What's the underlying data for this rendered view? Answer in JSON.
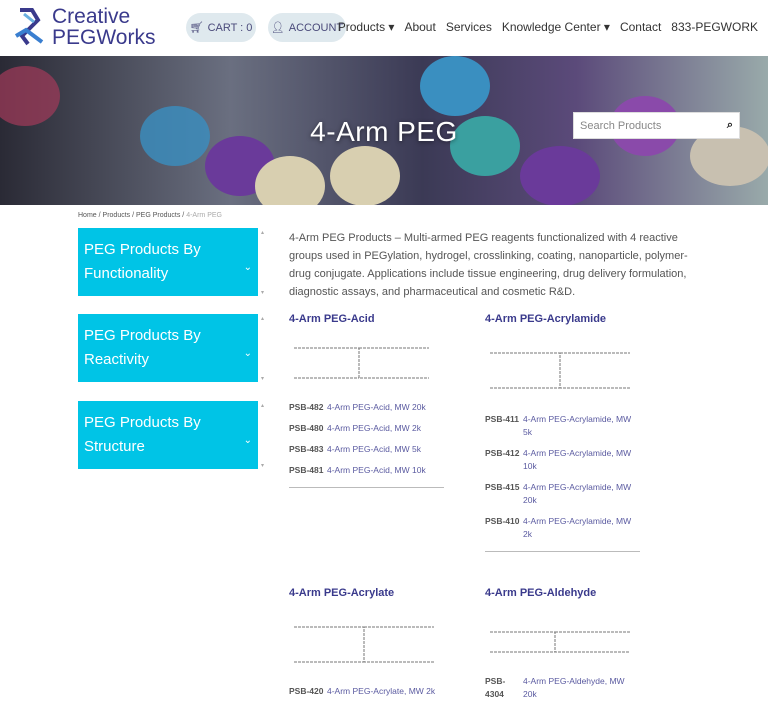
{
  "header": {
    "logo_line1": "Creative",
    "logo_line2": "PEGWorks",
    "cart": "CART : 0",
    "account": "ACCOUNT",
    "nav": [
      "Products",
      "About",
      "Services",
      "Knowledge Center",
      "Contact",
      "833-PEGWORK"
    ]
  },
  "banner": {
    "title": "4-Arm PEG",
    "search_placeholder": "Search Products"
  },
  "breadcrumb": {
    "items": [
      "Home",
      "Products",
      "PEG Products"
    ],
    "current": "4-Arm PEG"
  },
  "sidebar": [
    {
      "line1": "PEG Products By",
      "line2": "Functionality"
    },
    {
      "line1": "PEG Products By",
      "line2": "Reactivity"
    },
    {
      "line1": "PEG Products By",
      "line2": "Structure"
    }
  ],
  "intro": "4-Arm PEG Products – Multi-armed PEG reagents functionalized with 4 reactive groups used in PEGylation, hydrogel, crosslinking, coating, nanoparticle, polymer-drug conjugate. Applications include tissue engineering, drug delivery formulation, diagnostic assays, and pharmaceutical and cosmetic R&D.",
  "products": [
    {
      "title": "4-Arm PEG-Acid",
      "items": [
        {
          "code": "PSB-482",
          "name": "4-Arm PEG-Acid, MW 20k"
        },
        {
          "code": "PSB-480",
          "name": "4-Arm PEG-Acid, MW 2k"
        },
        {
          "code": "PSB-483",
          "name": "4-Arm PEG-Acid, MW 5k"
        },
        {
          "code": "PSB-481",
          "name": "4-Arm PEG-Acid, MW 10k"
        }
      ]
    },
    {
      "title": "4-Arm PEG-Acrylamide",
      "items": [
        {
          "code": "PSB-411",
          "name": "4-Arm PEG-Acrylamide, MW 5k"
        },
        {
          "code": "PSB-412",
          "name": "4-Arm PEG-Acrylamide, MW 10k"
        },
        {
          "code": "PSB-415",
          "name": "4-Arm PEG-Acrylamide, MW 20k"
        },
        {
          "code": "PSB-410",
          "name": "4-Arm PEG-Acrylamide, MW 2k"
        }
      ]
    },
    {
      "title": "4-Arm PEG-Acrylate",
      "items": [
        {
          "code": "PSB-420",
          "name": "4-Arm PEG-Acrylate, MW 2k"
        }
      ]
    },
    {
      "title": "4-Arm PEG-Aldehyde",
      "items": [
        {
          "code": "PSB-4304",
          "name": "4-Arm PEG-Aldehyde, MW 20k"
        }
      ]
    }
  ],
  "colors": {
    "brand": "#3a3a8c",
    "accent": "#00c4e6"
  }
}
